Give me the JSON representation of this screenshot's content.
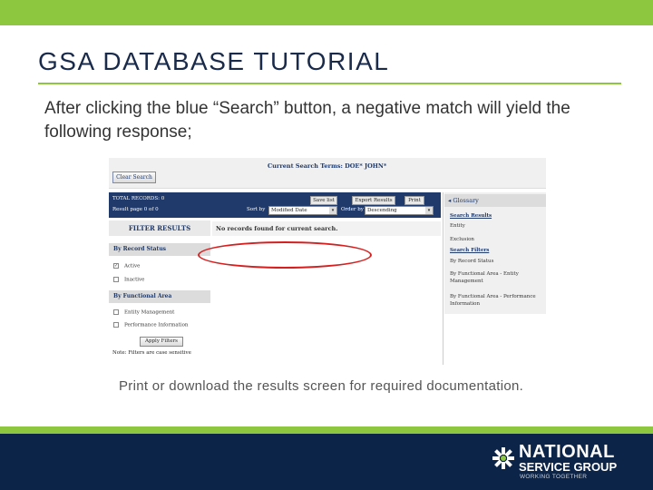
{
  "slide": {
    "title": "GSA DATABASE TUTORIAL",
    "intro": "After clicking the blue “Search” button,  a negative match will yield the following response;",
    "footer_note": "Print or download the results screen for required documentation."
  },
  "screenshot": {
    "current_search_terms": "Current Search Terms: DOE* JOHN*",
    "clear_search_label": "Clear Search",
    "toolbar": {
      "total_records": "TOTAL RECORDS: 0",
      "result_page": "Result page 0 of 0",
      "save_label": "Save list",
      "export_label": "Export Results",
      "print_label": "Print",
      "sort_by_label": "Sort by",
      "sort_by_value": "Modified Date",
      "order_by_label": "Order by",
      "order_by_value": "Descending"
    },
    "filter_results": {
      "title": "FILTER RESULTS",
      "record_status_heading": "By Record Status",
      "active_label": "Active",
      "active_checked": true,
      "inactive_label": "Inactive",
      "inactive_checked": false,
      "functional_area_heading": "By Functional Area",
      "entity_mgmt_label": "Entity Management",
      "entity_mgmt_checked": false,
      "performance_label": "Performance Information",
      "performance_checked": false,
      "apply_label": "Apply Filters",
      "note": "Note: Filters are case sensitive"
    },
    "no_records_message": "No records found for current search.",
    "glossary": {
      "title": "Glossary",
      "items": [
        {
          "label": "Search Results",
          "link": true
        },
        {
          "label": "Entity",
          "link": false
        },
        {
          "label": "Exclusion",
          "link": false
        },
        {
          "label": "Search Filters",
          "link": true
        },
        {
          "label": "By Record Status",
          "link": false
        },
        {
          "label": "By Functional Area - Entity Management",
          "link": false
        },
        {
          "label": "By Functional Area - Performance Information",
          "link": false
        }
      ]
    }
  },
  "branding": {
    "line1": "NATIONAL",
    "line2": "SERVICE GROUP",
    "line3": "WORKING TOGETHER"
  },
  "colors": {
    "accent_green": "#8dc63f",
    "navy": "#0c2447",
    "highlight_red": "#d62020"
  }
}
